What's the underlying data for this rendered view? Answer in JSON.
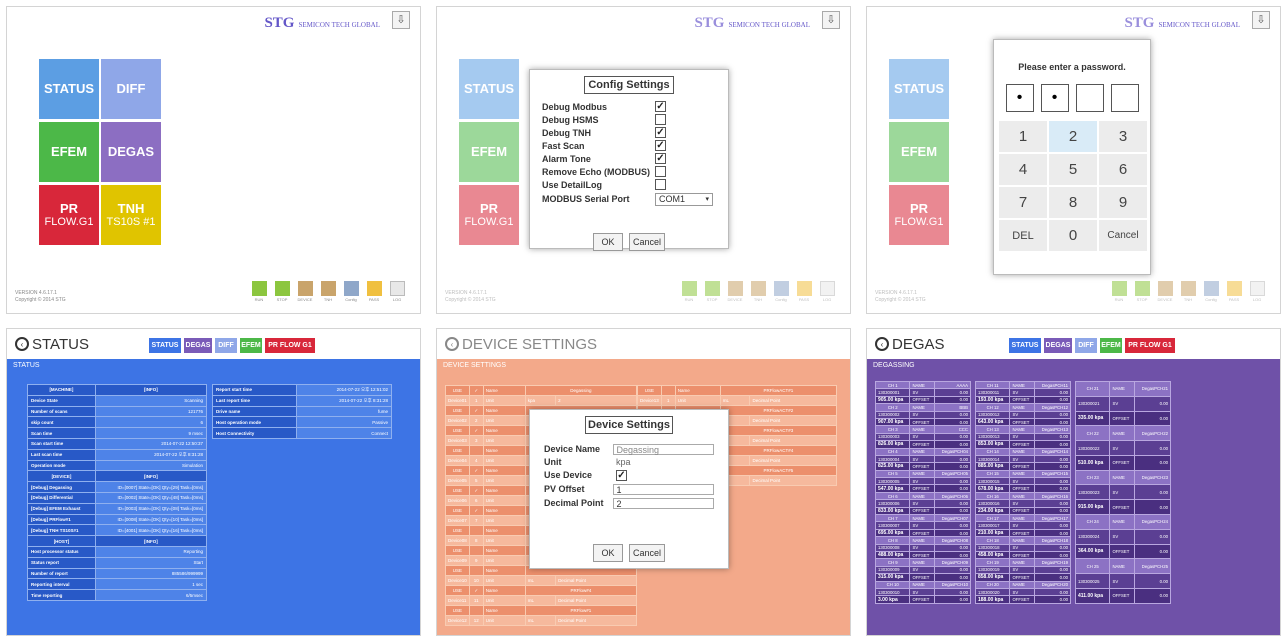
{
  "brand": {
    "name": "STG",
    "tagline": "SEMICON TECH GLOBAL"
  },
  "version": {
    "line1": "VERSION 4.6.17.1",
    "line2": "Copyright © 2014 STG"
  },
  "tiles": [
    {
      "l1": "STATUS",
      "l2": ""
    },
    {
      "l1": "DIFF",
      "l2": ""
    },
    {
      "l1": "EFEM",
      "l2": ""
    },
    {
      "l1": "DEGAS",
      "l2": ""
    },
    {
      "l1": "PR",
      "l2": "FLOW.G1"
    },
    {
      "l1": "TNH",
      "l2": "TS10S #1"
    }
  ],
  "toolbar": [
    {
      "label": "RUN"
    },
    {
      "label": "STOP"
    },
    {
      "label": "DEVICE"
    },
    {
      "label": "TNH"
    },
    {
      "label": "Config"
    },
    {
      "label": "PASS"
    },
    {
      "label": "LOG"
    }
  ],
  "config": {
    "title": "Config Settings",
    "rows": [
      {
        "label": "Debug Modbus",
        "checked": "✓"
      },
      {
        "label": "Debug HSMS",
        "checked": ""
      },
      {
        "label": "Debug TNH",
        "checked": "✓"
      },
      {
        "label": "Fast Scan",
        "checked": "✓"
      },
      {
        "label": "Alarm Tone",
        "checked": "✓"
      },
      {
        "label": "Remove Echo (MODBUS)",
        "checked": ""
      },
      {
        "label": "Use DetailLog",
        "checked": ""
      }
    ],
    "port_label": "MODBUS Serial Port",
    "port_value": "COM1",
    "ok": "OK",
    "cancel": "Cancel"
  },
  "password": {
    "title": "Please enter a password.",
    "boxes": [
      "•",
      "•",
      "",
      ""
    ],
    "keys": [
      "1",
      "2",
      "3",
      "4",
      "5",
      "6",
      "7",
      "8",
      "9",
      "DEL",
      "0",
      "Cancel"
    ]
  },
  "status_page": {
    "title": "STATUS",
    "section": "STATUS",
    "nav": [
      {
        "label": "STATUS"
      },
      {
        "label": "DEGAS"
      },
      {
        "label": "DIFF"
      },
      {
        "label": "EFEM"
      },
      {
        "label": "PR FLOW G1"
      }
    ],
    "left": [
      {
        "k": "[MACHINE]",
        "v": "[INFO]",
        "h": true
      },
      {
        "k": "Device State",
        "v": "Scanning"
      },
      {
        "k": "Number of scans",
        "v": "121776"
      },
      {
        "k": "skip count",
        "v": "6"
      },
      {
        "k": "Scan time",
        "v": "9 msec"
      },
      {
        "k": "Scan start time",
        "v": "2014-07-22 12:50:37"
      },
      {
        "k": "Last scan time",
        "v": "2014-07-22 오후 8:31:28"
      },
      {
        "k": "Operation mode",
        "v": "Simulation"
      },
      {
        "k": "[DEVICE]",
        "v": "[INFO]",
        "h": true
      },
      {
        "k": "[Debug] Degassing",
        "v": "ID=[0007] State=[OK] Qty=[29] Task=[0ms]"
      },
      {
        "k": "[Debug] Differential",
        "v": "ID=[0002] State=[OK] Qty=[48] Task=[0ms]"
      },
      {
        "k": "[Debug] EFEM Exhaust",
        "v": "ID=[0003] State=[OK] Qty=[08] Task=[0ms]"
      },
      {
        "k": "[Debug] PRFlow#1",
        "v": "ID=[0008] State=[OK] Qty=[10] Task=[0ms]"
      },
      {
        "k": "[Debug] TNH TS10S#1",
        "v": "ID=[4001] State=[OK] Qty=[16] Task=[0ms]"
      },
      {
        "k": "[HOST]",
        "v": "[INFO]",
        "h": true
      },
      {
        "k": "Host processor status",
        "v": "Reporting"
      },
      {
        "k": "Status report",
        "v": "Start"
      },
      {
        "k": "Number of report",
        "v": "885586/999999"
      },
      {
        "k": "Reporting interval",
        "v": "1 sec"
      },
      {
        "k": "Time reporting",
        "v": "6/5msec"
      }
    ],
    "right": [
      {
        "k": "Report start time",
        "v": "2014-07-22 오후 12:51:02"
      },
      {
        "k": "Last report time",
        "v": "2014-07-22 오후 8:31:28"
      },
      {
        "k": "Drive name",
        "v": "fume"
      },
      {
        "k": "Host operation mode",
        "v": "Passive"
      },
      {
        "k": "Host Connectivity",
        "v": "Connect"
      }
    ]
  },
  "device_page": {
    "title": "DEVICE SETTINGS",
    "section": "DEVICE SETTINGS",
    "use": "USE",
    "name": "Name",
    "unit": "Unit",
    "dp": "Decimal Point",
    "left_rows": [
      {
        "dev": "Device01",
        "num": "1",
        "name": "Degassing",
        "unit": "kpa",
        "dp": "2",
        "checked": "✓"
      },
      {
        "dev": "Device02",
        "num": "2",
        "name": "",
        "unit": "",
        "dp": "",
        "checked": "✓"
      },
      {
        "dev": "Device03",
        "num": "3",
        "name": "",
        "unit": "",
        "dp": "",
        "checked": "✓"
      },
      {
        "dev": "Device04",
        "num": "4",
        "name": "",
        "unit": "",
        "dp": "",
        "checked": ""
      },
      {
        "dev": "Device05",
        "num": "5",
        "name": "",
        "unit": "",
        "dp": "",
        "checked": "✓"
      },
      {
        "dev": "Device06",
        "num": "6",
        "name": "",
        "unit": "",
        "dp": "",
        "checked": "✓"
      },
      {
        "dev": "Device07",
        "num": "7",
        "name": "",
        "unit": "",
        "dp": "",
        "checked": "✓"
      },
      {
        "dev": "Device08",
        "num": "8",
        "name": "",
        "unit": "",
        "dp": "",
        "checked": ""
      },
      {
        "dev": "Device09",
        "num": "9",
        "name": "",
        "unit": "",
        "dp": "",
        "checked": ""
      },
      {
        "dev": "Device10",
        "num": "10",
        "name": "",
        "unit": "mL",
        "dp": "Decimal Point",
        "checked": ""
      },
      {
        "dev": "Device11",
        "num": "11",
        "name": "PRFlow#4",
        "unit": "mL",
        "dp": "Decimal Point",
        "checked": "✓"
      },
      {
        "dev": "Device12",
        "num": "12",
        "name": "PRFlow#1",
        "unit": "mL",
        "dp": "Decimal Point",
        "checked": ""
      }
    ],
    "right_rows": [
      {
        "dev": "Device13",
        "num": "1",
        "name": "PRFlowACT#1",
        "unit": "mL",
        "dp": "Decimal Point"
      },
      {
        "dev": "Device14",
        "num": "2",
        "name": "PRFlowACT#2",
        "unit": "",
        "dp": "Decimal Point"
      },
      {
        "dev": "Device15",
        "num": "3",
        "name": "PRFlowACT#3",
        "unit": "",
        "dp": "Decimal Point"
      },
      {
        "dev": "Device16",
        "num": "4",
        "name": "PRFlowACT#4",
        "unit": "",
        "dp": "Decimal Point"
      },
      {
        "dev": "Device17",
        "num": "5",
        "name": "PRFlowACT#5",
        "unit": "",
        "dp": "Decimal Point"
      }
    ],
    "dialog": {
      "title": "Device Settings",
      "name_label": "Device Name",
      "name_value": "Degassing",
      "unit_label": "Unit",
      "unit_value": "kpa",
      "use_label": "Use Device",
      "use_checked": "✓",
      "pv_label": "PV Offset",
      "pv_value": "1",
      "dp_label": "Decimal Point",
      "dp_value": "2",
      "ok": "OK",
      "cancel": "Cancel"
    }
  },
  "degas_page": {
    "title": "DEGAS",
    "section": "DEGASSING",
    "nav": [
      {
        "label": "STATUS"
      },
      {
        "label": "DEGAS"
      },
      {
        "label": "DIFF"
      },
      {
        "label": "EFEM"
      },
      {
        "label": "PR FLOW G1"
      }
    ],
    "name_lbl": "NAME",
    "sv_lbl": "SV",
    "offset_lbl": "OFFSET",
    "columns": [
      [
        {
          "ch": "CH 1",
          "id": "130300001",
          "name": "AAAA",
          "sv": "0.00",
          "val": "905.00 kpa",
          "off": "0.00"
        },
        {
          "ch": "CH 2",
          "id": "130300002",
          "name": "BBB",
          "sv": "0.00",
          "val": "907.00 kpa",
          "off": "0.00"
        },
        {
          "ch": "CH 3",
          "id": "130300003",
          "name": "CCC",
          "sv": "0.00",
          "val": "826.00 kpa",
          "off": "0.00"
        },
        {
          "ch": "CH 4",
          "id": "130300004",
          "name": "DegasPCH04",
          "sv": "0.00",
          "val": "825.00 kpa",
          "off": "0.00"
        },
        {
          "ch": "CH 5",
          "id": "130300005",
          "name": "DegasPCH05",
          "sv": "0.00",
          "val": "547.00 kpa",
          "off": "0.00"
        },
        {
          "ch": "CH 6",
          "id": "130300006",
          "name": "DegasPCH06",
          "sv": "0.00",
          "val": "833.00 kpa",
          "off": "0.00"
        },
        {
          "ch": "CH 7",
          "id": "130300007",
          "name": "DegasPCH07",
          "sv": "0.00",
          "val": "695.00 kpa",
          "off": "0.00"
        },
        {
          "ch": "CH 8",
          "id": "130300008",
          "name": "DegasPCH08",
          "sv": "0.00",
          "val": "488.00 kpa",
          "off": "0.00"
        },
        {
          "ch": "CH 9",
          "id": "130300009",
          "name": "DegasPCH09",
          "sv": "0.00",
          "val": "315.00 kpa",
          "off": "0.00"
        },
        {
          "ch": "CH 10",
          "id": "130300010",
          "name": "DegasPCH10",
          "sv": "0.00",
          "val": "3.00 kpa",
          "off": "0.00"
        }
      ],
      [
        {
          "ch": "CH 11",
          "id": "130300011",
          "name": "DegasPCH11",
          "sv": "0.00",
          "val": "193.00 kpa",
          "off": "0.00"
        },
        {
          "ch": "CH 12",
          "id": "130300012",
          "name": "DegasPCH12",
          "sv": "0.00",
          "val": "643.00 kpa",
          "off": "0.00"
        },
        {
          "ch": "CH 13",
          "id": "130300013",
          "name": "DegasPCH13",
          "sv": "0.00",
          "val": "853.00 kpa",
          "off": "0.00"
        },
        {
          "ch": "CH 14",
          "id": "130300014",
          "name": "DegasPCH14",
          "sv": "0.00",
          "val": "885.00 kpa",
          "off": "0.00"
        },
        {
          "ch": "CH 15",
          "id": "130300015",
          "name": "DegasPCH15",
          "sv": "0.00",
          "val": "678.00 kpa",
          "off": "0.00"
        },
        {
          "ch": "CH 16",
          "id": "130300016",
          "name": "DegasPCH16",
          "sv": "0.00",
          "val": "234.00 kpa",
          "off": "0.00"
        },
        {
          "ch": "CH 17",
          "id": "130300017",
          "name": "DegasPCH17",
          "sv": "0.00",
          "val": "210.00 kpa",
          "off": "0.00"
        },
        {
          "ch": "CH 18",
          "id": "130300018",
          "name": "DegasPCH18",
          "sv": "0.00",
          "val": "458.00 kpa",
          "off": "0.00"
        },
        {
          "ch": "CH 19",
          "id": "130300019",
          "name": "DegasPCH19",
          "sv": "0.00",
          "val": "858.00 kpa",
          "off": "0.00"
        },
        {
          "ch": "CH 20",
          "id": "130300020",
          "name": "DegasPCH20",
          "sv": "0.00",
          "val": "188.00 kpa",
          "off": "0.00"
        }
      ],
      [
        {
          "ch": "CH 21",
          "id": "130300021",
          "name": "DegasPCH21",
          "sv": "0.00",
          "val": "335.00 kpa",
          "off": "0.00"
        },
        {
          "ch": "CH 22",
          "id": "130300022",
          "name": "DegasPCH22",
          "sv": "0.00",
          "val": "510.00 kpa",
          "off": "0.00"
        },
        {
          "ch": "CH 23",
          "id": "130300023",
          "name": "DegasPCH23",
          "sv": "0.00",
          "val": "915.00 kpa",
          "off": "0.00"
        },
        {
          "ch": "CH 24",
          "id": "130300024",
          "name": "DegasPCH24",
          "sv": "0.00",
          "val": "364.00 kpa",
          "off": "0.00"
        },
        {
          "ch": "CH 25",
          "id": "130300025",
          "name": "DegasPCH25",
          "sv": "0.00",
          "val": "411.00 kpa",
          "off": "0.00"
        }
      ]
    ]
  },
  "colors": {
    "status_blue": "#3d74e5",
    "device_salmon": "#f3a98a",
    "degas_purple": "#6f51a8",
    "efem_green": "#4cb848",
    "diff_blue": "#8fa7e8",
    "pr_red": "#d8273a",
    "tnh_yellow": "#e0c400",
    "degas_tile": "#8c6ec2"
  }
}
